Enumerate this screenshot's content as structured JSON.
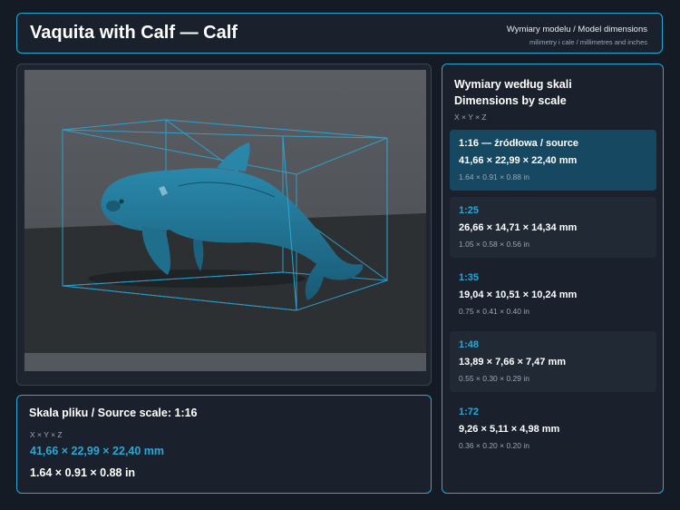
{
  "header": {
    "title": "Vaquita with Calf — Calf",
    "subtitle": "Wymiary modelu / Model dimensions",
    "subtitle_small": "milimetry i cale / millimetres and inches"
  },
  "source": {
    "title": "Skala pliku / Source scale: 1:16",
    "axes": "X × Y × Z",
    "mm": "41,66 × 22,99 × 22,40 mm",
    "inches": "1.64 × 0.91 × 0.88 in"
  },
  "scales": {
    "title_line1": "Wymiary według skali",
    "title_line2": "Dimensions by scale",
    "axes": "X × Y × Z",
    "rows": [
      {
        "scale": "1:16  —  źródłowa / source",
        "mm": "41,66 × 22,99 × 22,40 mm",
        "inches": "1.64 × 0.91 × 0.88 in"
      },
      {
        "scale": "1:25",
        "mm": "26,66 × 14,71 × 14,34 mm",
        "inches": "1.05 × 0.58 × 0.56 in"
      },
      {
        "scale": "1:35",
        "mm": "19,04 × 10,51 × 10,24 mm",
        "inches": "0.75 × 0.41 × 0.40 in"
      },
      {
        "scale": "1:48",
        "mm": "13,89 × 7,66 × 7,47 mm",
        "inches": "0.55 × 0.30 × 0.29 in"
      },
      {
        "scale": "1:72",
        "mm": "9,26 × 5,11 × 4,98 mm",
        "inches": "0.36 × 0.20 × 0.20 in"
      }
    ]
  },
  "colors": {
    "accent": "#2ba7d6",
    "background": "#151b24",
    "panel": "#1a212c",
    "active_row": "#174861",
    "model": "#1f6e8c"
  }
}
